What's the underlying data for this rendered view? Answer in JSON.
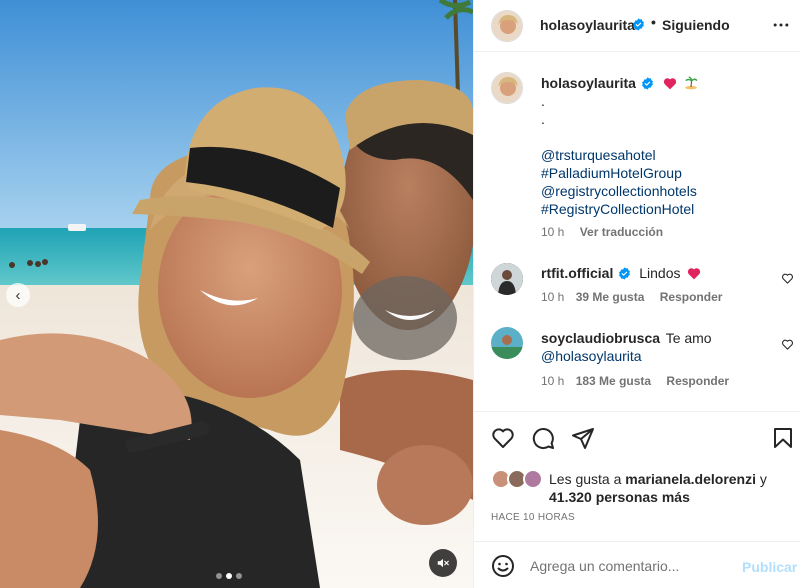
{
  "post": {
    "author": "holasoylaurita",
    "follow_dot": "•",
    "follow_state": "Siguiendo",
    "caption_lines": [
      ".",
      "."
    ],
    "caption_tags": [
      "@trsturquesahotel",
      "#PalladiumHotelGroup",
      "@registrycollectionhotels",
      "#RegistryCollectionHotel"
    ],
    "caption_time": "10 h",
    "translate": "Ver traducción"
  },
  "comments": [
    {
      "user": "rtfit.official",
      "text": "Lindos",
      "time": "10 h",
      "likes": "39 Me gusta",
      "reply": "Responder"
    },
    {
      "user": "soyclaudiobrusca",
      "text": "Te amo",
      "mention": "@holasoylaurita",
      "time": "10 h",
      "likes": "183 Me gusta",
      "reply": "Responder"
    }
  ],
  "likes": {
    "prefix": "Les gusta a",
    "user": "marianela.delorenzi",
    "joiner": "y",
    "count": "41.320 personas más"
  },
  "time_ago": "HACE 10 HORAS",
  "composer": {
    "placeholder": "Agrega un comentario...",
    "publish": "Publicar"
  },
  "icons": {
    "verified": "verified-badge-icon",
    "heart": "heart-icon",
    "comment": "comment-icon",
    "share": "share-icon",
    "save": "bookmark-icon",
    "more": "more-icon",
    "emoji": "emoji-icon",
    "mute": "muted-speaker-icon"
  },
  "colors": {
    "accent": "#0095f6",
    "heart": "#ed4956",
    "link": "#00376b",
    "muted": "#737373"
  },
  "carousel": {
    "count": 3,
    "active": 2
  }
}
